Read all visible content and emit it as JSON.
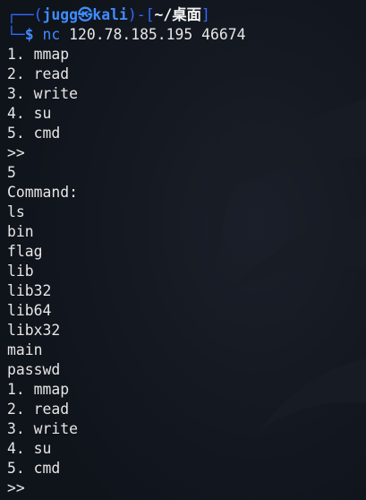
{
  "prompt": {
    "top_open": "┌──(",
    "user": "jugg",
    "skull": "㉿",
    "host": "kali",
    "mid": ")-[",
    "path": "~/桌面",
    "close": "]",
    "bottom": "└─",
    "symbol": "$"
  },
  "command": {
    "name": "nc",
    "args": "120.78.185.195 46674"
  },
  "output": [
    "1. mmap",
    "2. read",
    "3. write",
    "4. su",
    "5. cmd",
    ">>",
    "5",
    "Command:",
    "ls",
    "bin",
    "flag",
    "lib",
    "lib32",
    "lib64",
    "libx32",
    "main",
    "passwd",
    "1. mmap",
    "2. read",
    "3. write",
    "4. su",
    "5. cmd",
    ">>"
  ]
}
